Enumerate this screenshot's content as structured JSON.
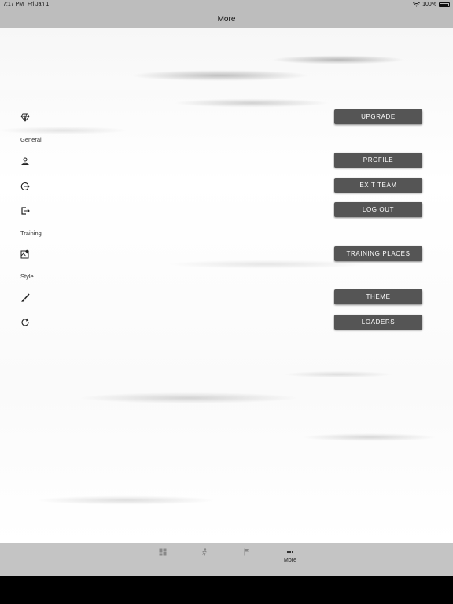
{
  "status_bar": {
    "time": "7:17 PM",
    "date": "Fri Jan 1",
    "battery": "100%"
  },
  "nav": {
    "title": "More"
  },
  "sections": {
    "general": "General",
    "training": "Training",
    "style": "Style"
  },
  "buttons": {
    "upgrade": "UPGRADE",
    "profile": "PROFILE",
    "exit_team": "EXIT TEAM",
    "log_out": "LOG OUT",
    "training_places": "TRAINING PLACES",
    "theme": "THEME",
    "loaders": "LOADERS"
  },
  "icons": {
    "upgrade": "diamond-icon",
    "profile": "person-icon",
    "exit_team": "exit-team-icon",
    "log_out": "logout-icon",
    "training_places": "map-pin-icon",
    "theme": "brush-icon",
    "loaders": "refresh-icon"
  },
  "tabs": [
    {
      "icon": "dashboard-icon",
      "label": ""
    },
    {
      "icon": "runner-icon",
      "label": ""
    },
    {
      "icon": "flag-icon",
      "label": ""
    },
    {
      "icon": "more-icon",
      "label": "More"
    }
  ]
}
